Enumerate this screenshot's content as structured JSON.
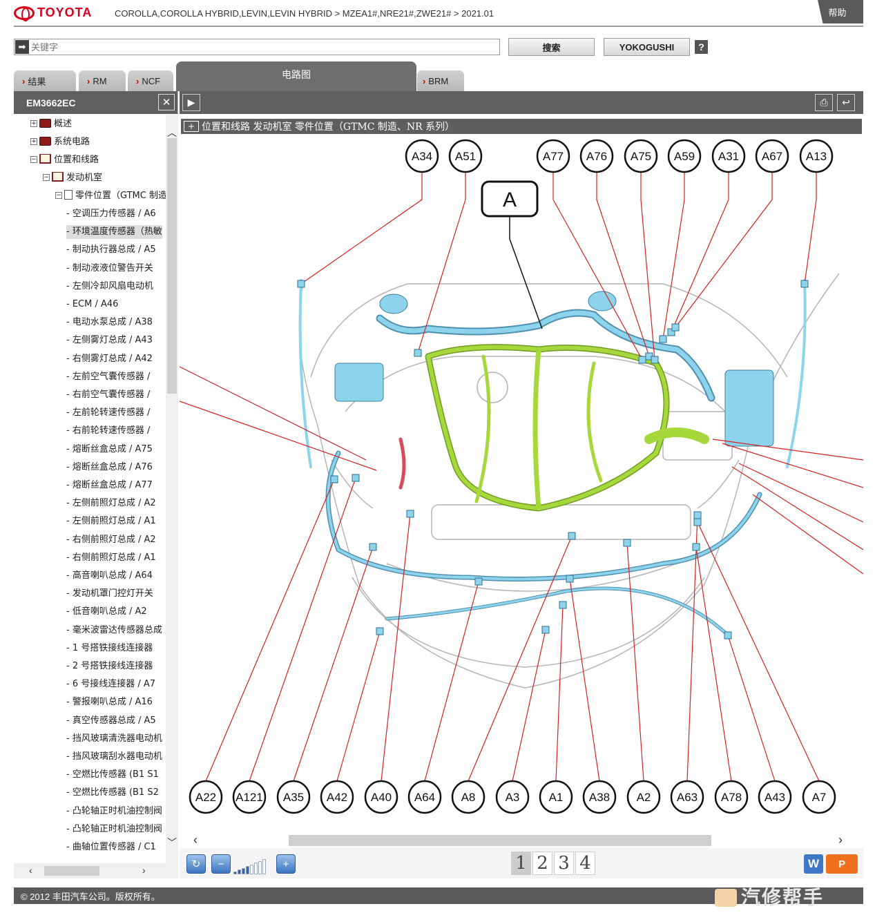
{
  "header": {
    "brand": "TOYOTA",
    "breadcrumb": "COROLLA,COROLLA HYBRID,LEVIN,LEVIN HYBRID > MZEA1#,NRE21#,ZWE21# > 2021.01",
    "help": "帮助"
  },
  "search": {
    "placeholder": "关键字",
    "search_button": "搜索",
    "yokogushi_button": "YOKOGUSHI",
    "question_button": "?"
  },
  "tabs": [
    {
      "label": "结果"
    },
    {
      "label": "RM"
    },
    {
      "label": "NCF"
    },
    {
      "label": "电路图",
      "active": true
    },
    {
      "label": "BRM"
    }
  ],
  "left_panel": {
    "title": "EM3662EC",
    "close": "✕",
    "tree": [
      {
        "label": "概述",
        "level": 0
      },
      {
        "label": "系统电路",
        "level": 0
      },
      {
        "label": "位置和线路",
        "level": 0
      },
      {
        "label": "发动机室",
        "level": 1
      },
      {
        "label": "零件位置（GTMC 制造",
        "level": 2
      }
    ],
    "items": [
      "空调压力传感器 / A6",
      "环境温度传感器（热敏",
      "制动执行器总成 / A5",
      "制动液液位警告开关",
      "左侧冷却风扇电动机",
      "ECM / A46",
      "电动水泵总成 / A38",
      "左侧雾灯总成 / A43",
      "右侧雾灯总成 / A42",
      "左前空气囊传感器 /",
      "右前空气囊传感器 /",
      "左前轮转速传感器 /",
      "右前轮转速传感器 /",
      "熔断丝盒总成 / A75",
      "熔断丝盒总成 / A76",
      "熔断丝盒总成 / A77",
      "左侧前照灯总成 / A2",
      "左侧前照灯总成 / A1",
      "右侧前照灯总成 / A2",
      "右侧前照灯总成 / A1",
      "高音喇叭总成 / A64",
      "发动机罩门控灯开关",
      "低音喇叭总成 / A2",
      "毫米波雷达传感器总成",
      "1 号搭铁接线连接器",
      "2 号搭铁接线连接器",
      "6 号接线连接器 / A7",
      "警报喇叭总成 / A16",
      "真空传感器总成 / A5",
      "挡风玻璃清洗器电动机",
      "挡风玻璃刮水器电动机",
      "空燃比传感器 (B1 S1",
      "空燃比传感器 (B1 S2",
      "凸轮轴正时机油控制阀",
      "凸轮轴正时机油控制阀",
      "曲轴位置传感器 / C1"
    ],
    "selected_index": 1
  },
  "diagram": {
    "title": "位置和线路  发动机室  零件位置（GTMC 制造、NR 系列）",
    "title_box": "+",
    "callout": "A",
    "top_labels": [
      "A34",
      "A51",
      "A77",
      "A76",
      "A75",
      "A59",
      "A31",
      "A67",
      "A13"
    ],
    "bottom_labels": [
      "A22",
      "A121",
      "A35",
      "A42",
      "A40",
      "A64",
      "A8",
      "A3",
      "A1",
      "A38",
      "A2",
      "A63",
      "A78",
      "A43",
      "A7"
    ]
  },
  "toolbar": {
    "refresh_icon": "↻",
    "zoom_out_icon": "−",
    "zoom_in_icon": "+",
    "zoom_level": "4",
    "pages": [
      "1",
      "2",
      "3",
      "4"
    ],
    "current_page": "1",
    "word_button": "W",
    "ppt_button": "P"
  },
  "footer": {
    "copyright": "© 2012 丰田汽车公司。版权所有。",
    "watermark": "汽修帮手"
  },
  "colors": {
    "brand_red": "#d8001c",
    "header_gray": "#5f5f5f",
    "harness_green": "#9acd32",
    "harness_blue": "#7ec8e3",
    "leader_red": "#d62020"
  }
}
